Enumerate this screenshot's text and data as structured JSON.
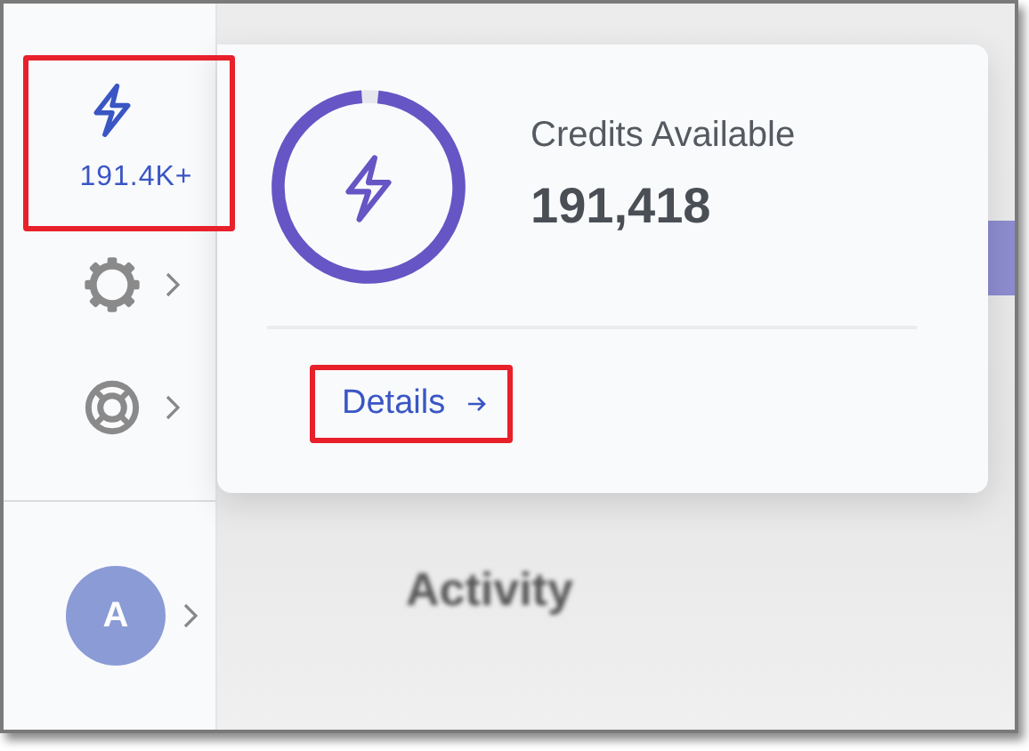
{
  "sidebar": {
    "credits": {
      "label": "191.4K+",
      "highlighted": true
    },
    "items": [
      {
        "kind": "settings"
      },
      {
        "kind": "help"
      }
    ],
    "avatar": {
      "initial": "A"
    }
  },
  "background": {
    "heading": "Activity"
  },
  "popup": {
    "gauge": {
      "level": 0.97
    },
    "title": "Credits Available",
    "value": "191,418",
    "link": {
      "label": "Details",
      "highlighted": true
    }
  }
}
